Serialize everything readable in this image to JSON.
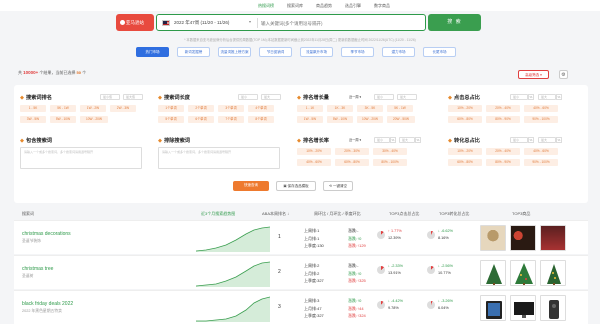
{
  "topnav": {
    "items": [
      {
        "label": "热搜词榜",
        "active": true
      },
      {
        "label": "搜索词库",
        "active": false
      },
      {
        "label": "商品趋势",
        "active": false
      },
      {
        "label": "选品引擎",
        "active": false
      },
      {
        "label": "数字商品",
        "active": false
      }
    ]
  },
  "search": {
    "brand_label": "亚马逊站",
    "week_label": "2022 年47周 (11/20 - 11/26)",
    "placeholder": "输入关键词(多个请用逗号隔开)",
    "button_label": "搜 索",
    "note": "* 本数据来自亚马逊品牌分析后台提供的周数据(TOP 1M);本站数据更新时间截止到2022年11月28日(周二) 更新前数据截止时间 2022/11/26(UTC) (11/20 - 11/26)"
  },
  "tabs": [
    "热门市场",
    "新词发掘榜",
    "流量词推上榜方案",
    "节日促销词",
    "流量飙升市场",
    "季节市场",
    "潜力市场",
    "长尾市场"
  ],
  "results": {
    "prefix": "共",
    "count": "10000+",
    "middle": "个结果，当前已选择",
    "selected": "50",
    "suffix": "个",
    "advanced_filter": "高级筛选 ▾",
    "settings_icon": "gear-icon"
  },
  "filters": {
    "search_rank": {
      "title": "搜索词排名",
      "mini_a": "最小值",
      "mini_b": "最大值",
      "chips": [
        "1 - 5K",
        "5K - 1W",
        "1W - 2W",
        "2W - 3W",
        "3W - 5W",
        "5W - 10W",
        "10W - 20W"
      ]
    },
    "keyword_len": {
      "title": "搜索词长度",
      "mini_a": "最小",
      "mini_b": "最大",
      "chips": [
        "1个单词",
        "2个单词",
        "3个单词",
        "4个单词",
        "5个单词",
        "6个单词",
        "7个单词",
        "8个单词"
      ]
    },
    "rank_growth_value": {
      "title": "排名增长量",
      "period": "近一周",
      "mini_a": "最小",
      "mini_b": "最大",
      "chips": [
        "1 - 1K",
        "1K - 3K",
        "3K - 5K",
        "5K - 1W",
        "1W - 5W",
        "5W - 10W",
        "10W - 20W",
        "20W - 50W"
      ]
    },
    "click_share": {
      "title": "点击总占比",
      "mini_a": "最小",
      "pct_a": "%",
      "mini_b": "最大",
      "pct_b": "%",
      "chips": [
        "10% - 20%",
        "20% - 40%",
        "40% - 60%",
        "60% - 80%",
        "80% - 90%",
        "90% - 100%"
      ]
    },
    "include": {
      "title": "包含搜索词",
      "placeholder": "请输入一个或多个搜索词，多个搜索词请用逗号隔开"
    },
    "exclude": {
      "title": "排除搜索词",
      "placeholder": "请输入一个或多个搜索词，多个搜索词请用逗号隔开"
    },
    "rank_growth_rate": {
      "title": "排名增长率",
      "period": "近一周",
      "mini_a": "最小",
      "pct_a": "%",
      "mini_b": "最大",
      "pct_b": "%",
      "chips": [
        "10% - 20%",
        "20% - 30%",
        "30% - 40%",
        "40% - 60%",
        "60% - 80%",
        "80% - 100%"
      ]
    },
    "conversion_share": {
      "title": "转化总占比",
      "mini_a": "最小",
      "pct_a": "%",
      "mini_b": "最大",
      "pct_b": "%",
      "chips": [
        "10% - 20%",
        "20% - 40%",
        "40% - 60%",
        "60% - 80%",
        "80% - 90%",
        "90% - 100%"
      ]
    },
    "actions": {
      "query": "快速查询",
      "save": "保存选品模板",
      "reset": "一键清空"
    }
  },
  "table": {
    "headers": {
      "keyword": "搜索词",
      "trend": "近3个月搜索趋势图",
      "aba": "ABA本周排名 ↓",
      "rank_change": "周环比 / 月环比 / 季度环比",
      "click_share": "TOP3点击总占比",
      "conv_share": "TOP3转化总占比",
      "products": "TOP3商品"
    },
    "rows": [
      {
        "keyword": "christmas decorations",
        "sub": "圣诞节装饰",
        "aba_rank": "1",
        "last_week": "上周排:1",
        "last_month": "上月排:1",
        "last_quarter": "上季度:130",
        "chg_week": "涨跌:-",
        "chg_month": "涨跌:↑0",
        "chg_quarter": "涨跌:↑129",
        "click_change": "↑ 1.77%",
        "click_val": "12.39%",
        "conv_change": "↓ -6.62%",
        "conv_val": "8.16%",
        "products": [
          "wreath-photo",
          "ornament-photo",
          "gnome-photo"
        ]
      },
      {
        "keyword": "christmas tree",
        "sub": "圣诞树",
        "aba_rank": "2",
        "last_week": "上周排:2",
        "last_month": "上月排:2",
        "last_quarter": "上季度:327",
        "chg_week": "涨跌:-",
        "chg_month": "涨跌:↑0",
        "chg_quarter": "涨跌:↑325",
        "click_change": "↓ -2.33%",
        "click_val": "13.91%",
        "conv_change": "↓ -2.56%",
        "conv_val": "10.77%",
        "products": [
          "tree-photo-1",
          "tree-photo-2",
          "tree-photo-3"
        ]
      },
      {
        "keyword": "black friday deals 2022",
        "sub": "2022 年黑色星期五特卖",
        "aba_rank": "3",
        "last_week": "上周排:3",
        "last_month": "上月排:47",
        "last_quarter": "上季度:327",
        "chg_week": "涨跌:↑0",
        "chg_month": "涨跌:↑44",
        "chg_quarter": "涨跌:↑324",
        "click_change": "↓ -4.42%",
        "click_val": "9.78%",
        "conv_change": "↓ -3.26%",
        "conv_val": "6.04%",
        "products": [
          "tablet-photo",
          "tv-photo",
          "speaker-photo"
        ]
      }
    ]
  },
  "colors": {
    "accent_green": "#2e9a4a",
    "brand_red": "#e84a3e",
    "tab_blue": "#2f6ee0",
    "chip_orange": "#e07a3a"
  }
}
